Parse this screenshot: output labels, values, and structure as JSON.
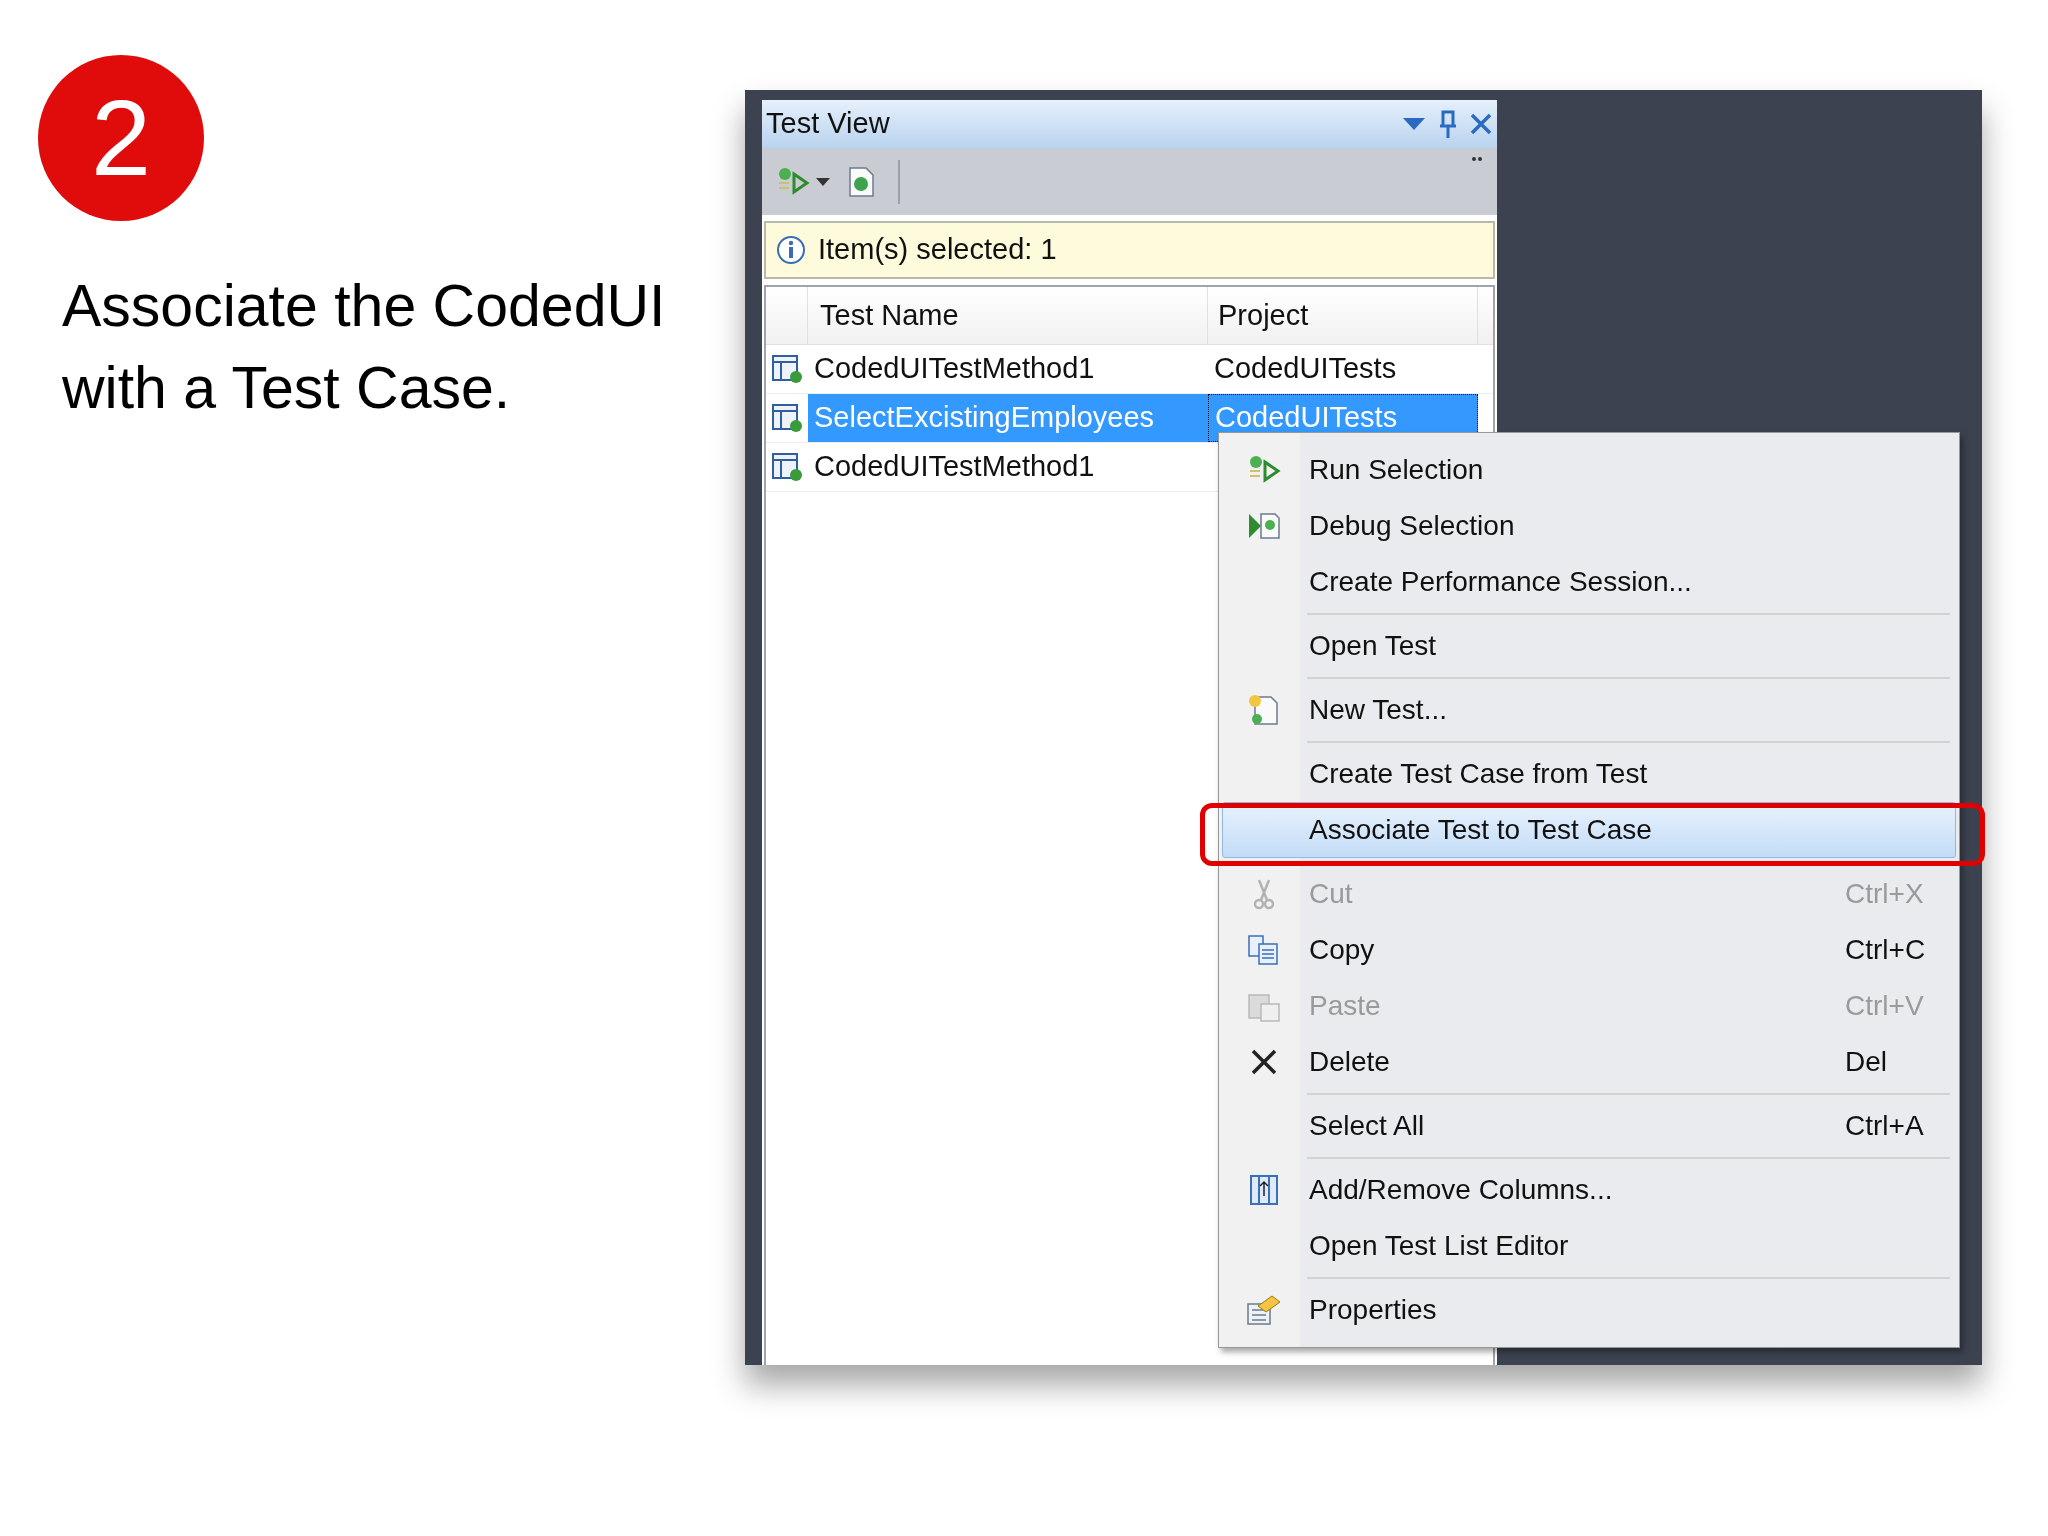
{
  "slide": {
    "step_number": "2",
    "caption": "Associate the CodedUI with a Test Case."
  },
  "window": {
    "title": "Test View"
  },
  "info_bar": {
    "text": "Item(s) selected: 1"
  },
  "table": {
    "columns": [
      "Test Name",
      "Project"
    ],
    "rows": [
      {
        "name": "CodedUITestMethod1",
        "project": "CodedUITests",
        "selected": false
      },
      {
        "name": "SelectExcistingEmployees",
        "project": "CodedUITests",
        "selected": true
      },
      {
        "name": "CodedUITestMethod1",
        "project": "",
        "selected": false
      }
    ]
  },
  "context_menu": {
    "items": [
      {
        "kind": "run",
        "label": "Run Selection",
        "selected": false,
        "disabled": false
      },
      {
        "kind": "debug",
        "label": "Debug Selection",
        "selected": false,
        "disabled": false
      },
      {
        "kind": "plain",
        "label": "Create Performance Session...",
        "selected": false,
        "disabled": false
      },
      {
        "kind": "separator"
      },
      {
        "kind": "plain",
        "label": "Open Test",
        "selected": false,
        "disabled": false
      },
      {
        "kind": "separator"
      },
      {
        "kind": "new",
        "label": "New Test...",
        "selected": false,
        "disabled": false
      },
      {
        "kind": "separator"
      },
      {
        "kind": "plain",
        "label": "Create Test Case from Test",
        "selected": false,
        "disabled": false
      },
      {
        "kind": "plain",
        "label": "Associate Test to Test Case",
        "selected": true,
        "disabled": false
      },
      {
        "kind": "separator"
      },
      {
        "kind": "cut",
        "label": "Cut",
        "shortcut": "Ctrl+X",
        "selected": false,
        "disabled": true
      },
      {
        "kind": "copy",
        "label": "Copy",
        "shortcut": "Ctrl+C",
        "selected": false,
        "disabled": false
      },
      {
        "kind": "paste",
        "label": "Paste",
        "shortcut": "Ctrl+V",
        "selected": false,
        "disabled": true
      },
      {
        "kind": "delete",
        "label": "Delete",
        "shortcut": "Del",
        "selected": false,
        "disabled": false
      },
      {
        "kind": "separator"
      },
      {
        "kind": "plain",
        "label": "Select All",
        "shortcut": "Ctrl+A",
        "selected": false,
        "disabled": false
      },
      {
        "kind": "separator"
      },
      {
        "kind": "columns",
        "label": "Add/Remove Columns...",
        "selected": false,
        "disabled": false
      },
      {
        "kind": "plain",
        "label": "Open Test List Editor",
        "selected": false,
        "disabled": false
      },
      {
        "kind": "separator"
      },
      {
        "kind": "properties",
        "label": "Properties",
        "selected": false,
        "disabled": false
      }
    ]
  }
}
